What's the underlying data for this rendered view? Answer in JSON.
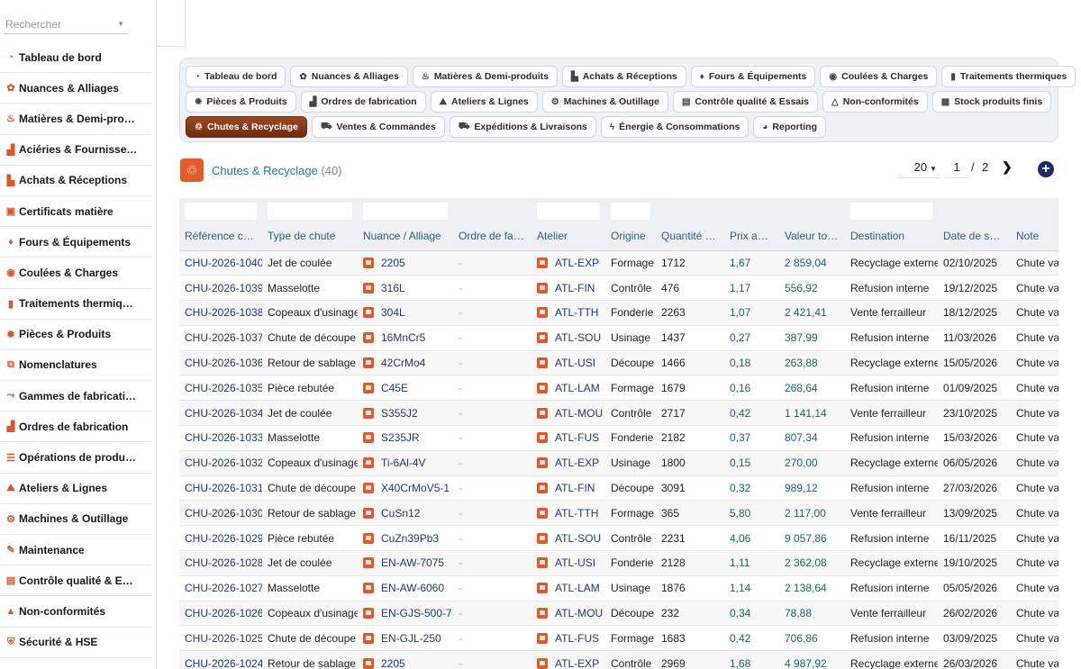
{
  "sidebar": {
    "search_placeholder": "Rechercher",
    "items": [
      {
        "label": "Tableau de bord",
        "icon": "dashboard-icon",
        "glyph": "◔"
      },
      {
        "label": "Nuances & Alliages",
        "icon": "gear-icon",
        "glyph": "✿"
      },
      {
        "label": "Matières & Demi-pro…",
        "icon": "materials-icon",
        "glyph": "♨"
      },
      {
        "label": "Aciéries & Fournisse…",
        "icon": "factory-icon",
        "glyph": "▟"
      },
      {
        "label": "Achats & Réceptions",
        "icon": "truck-icon",
        "glyph": "▙"
      },
      {
        "label": "Certificats matière",
        "icon": "certificate-icon",
        "glyph": "▣"
      },
      {
        "label": "Fours & Équipements",
        "icon": "fire-icon",
        "glyph": "♦"
      },
      {
        "label": "Coulées & Charges",
        "icon": "pour-icon",
        "glyph": "◉"
      },
      {
        "label": "Traitements thermiq…",
        "icon": "thermometer-icon",
        "glyph": "▮"
      },
      {
        "label": "Pièces & Produits",
        "icon": "part-icon",
        "glyph": "✹"
      },
      {
        "label": "Nomenclatures",
        "icon": "hierarchy-icon",
        "glyph": "⧉"
      },
      {
        "label": "Gammes de fabricati…",
        "icon": "routing-icon",
        "glyph": "⤳"
      },
      {
        "label": "Ordres de fabrication",
        "icon": "factory-icon",
        "glyph": "▟"
      },
      {
        "label": "Opérations de produ…",
        "icon": "list-icon",
        "glyph": "☰"
      },
      {
        "label": "Ateliers & Lignes",
        "icon": "workshop-icon",
        "glyph": "⛰"
      },
      {
        "label": "Machines & Outillage",
        "icon": "cogs-icon",
        "glyph": "⚙"
      },
      {
        "label": "Maintenance",
        "icon": "wrench-icon",
        "glyph": "✎"
      },
      {
        "label": "Contrôle qualité & E…",
        "icon": "clipboard-icon",
        "glyph": "▤"
      },
      {
        "label": "Non-conformités",
        "icon": "warning-icon",
        "glyph": "▲"
      },
      {
        "label": "Sécurité & HSE",
        "icon": "shield-icon",
        "glyph": "⛨"
      }
    ]
  },
  "tabs": {
    "rows": [
      [
        {
          "label": "Tableau de bord",
          "icon": "dashboard-icon",
          "glyph": "◔"
        },
        {
          "label": "Nuances & Alliages",
          "icon": "gear-icon",
          "glyph": "✿"
        },
        {
          "label": "Matières & Demi-produits",
          "icon": "materials-icon",
          "glyph": "♨"
        },
        {
          "label": "Achats & Réceptions",
          "icon": "truck-icon",
          "glyph": "▙"
        },
        {
          "label": "Fours & Équipements",
          "icon": "fire-icon",
          "glyph": "♦"
        },
        {
          "label": "Coulées & Charges",
          "icon": "pour-icon",
          "glyph": "◉"
        },
        {
          "label": "Traitements thermiques",
          "icon": "thermometer-icon",
          "glyph": "▮"
        }
      ],
      [
        {
          "label": "Pièces & Produits",
          "icon": "part-icon",
          "glyph": "✹"
        },
        {
          "label": "Ordres de fabrication",
          "icon": "factory-icon",
          "glyph": "▟"
        },
        {
          "label": "Ateliers & Lignes",
          "icon": "workshop-icon",
          "glyph": "⛰"
        },
        {
          "label": "Machines & Outillage",
          "icon": "cogs-icon",
          "glyph": "⚙"
        },
        {
          "label": "Contrôle qualité & Essais",
          "icon": "clipboard-icon",
          "glyph": "▤"
        },
        {
          "label": "Non-conformités",
          "icon": "warning-icon",
          "glyph": "△"
        },
        {
          "label": "Stock produits finis",
          "icon": "warehouse-icon",
          "glyph": "▦"
        }
      ],
      [
        {
          "label": "Chutes & Recyclage",
          "icon": "recycle-icon",
          "glyph": "♲",
          "active": true
        },
        {
          "label": "Ventes & Commandes",
          "icon": "cart-icon",
          "glyph": "⛟"
        },
        {
          "label": "Expéditions & Livraisons",
          "icon": "truck-icon",
          "glyph": "⛟"
        },
        {
          "label": "Énergie & Consommations",
          "icon": "bolt-icon",
          "glyph": "ϟ"
        },
        {
          "label": "Reporting",
          "icon": "chart-icon",
          "glyph": "◕"
        }
      ]
    ]
  },
  "page": {
    "title": "Chutes & Recyclage",
    "count": "(40)",
    "page_size": "20",
    "current_page": "1",
    "separator": "/",
    "total_pages": "2"
  },
  "table": {
    "columns": [
      "Référence ch…",
      "Type de chute",
      "Nuance / Alliage",
      "Ordre de fab…",
      "Atelier",
      "Origine",
      "Quantité (kg)",
      "Prix au kg",
      "Valeur totale",
      "Destination",
      "Date de sortie",
      "Note"
    ],
    "rows": [
      [
        "CHU-2026-1040",
        "Jet de coulée",
        "2205",
        "-",
        "ATL-EXP",
        "Formage",
        "1712",
        "1,67",
        "2 859,04",
        "Recyclage externe",
        "02/10/2025",
        "Chute val"
      ],
      [
        "CHU-2026-1039",
        "Masselotte",
        "316L",
        "-",
        "ATL-FIN",
        "Contrôle",
        "476",
        "1,17",
        "556,92",
        "Refusion interne",
        "19/12/2025",
        "Chute val"
      ],
      [
        "CHU-2026-1038",
        "Copeaux d'usinage",
        "304L",
        "-",
        "ATL-TTH",
        "Fonderie",
        "2263",
        "1,07",
        "2 421,41",
        "Vente ferrailleur",
        "18/12/2025",
        "Chute val"
      ],
      [
        "CHU-2026-1037",
        "Chute de découpe",
        "16MnCr5",
        "-",
        "ATL-SOU",
        "Usinage",
        "1437",
        "0,27",
        "387,99",
        "Refusion interne",
        "11/03/2026",
        "Chute val"
      ],
      [
        "CHU-2026-1036",
        "Retour de sablage",
        "42CrMo4",
        "-",
        "ATL-USI",
        "Découpe",
        "1466",
        "0,18",
        "263,88",
        "Recyclage externe",
        "15/05/2026",
        "Chute val"
      ],
      [
        "CHU-2026-1035",
        "Pièce rebutée",
        "C45E",
        "-",
        "ATL-LAM",
        "Formage",
        "1679",
        "0,16",
        "268,64",
        "Refusion interne",
        "01/09/2025",
        "Chute val"
      ],
      [
        "CHU-2026-1034",
        "Jet de coulée",
        "S355J2",
        "-",
        "ATL-MOU",
        "Contrôle",
        "2717",
        "0,42",
        "1 141,14",
        "Vente ferrailleur",
        "23/10/2025",
        "Chute val"
      ],
      [
        "CHU-2026-1033",
        "Masselotte",
        "S235JR",
        "-",
        "ATL-FUS",
        "Fonderie",
        "2182",
        "0,37",
        "807,34",
        "Refusion interne",
        "15/03/2026",
        "Chute val"
      ],
      [
        "CHU-2026-1032",
        "Copeaux d'usinage",
        "Ti-6Al-4V",
        "-",
        "ATL-EXP",
        "Usinage",
        "1800",
        "0,15",
        "270,00",
        "Recyclage externe",
        "06/05/2026",
        "Chute val"
      ],
      [
        "CHU-2026-1031",
        "Chute de découpe",
        "X40CrMoV5-1",
        "-",
        "ATL-FIN",
        "Découpe",
        "3091",
        "0,32",
        "989,12",
        "Refusion interne",
        "27/03/2026",
        "Chute val"
      ],
      [
        "CHU-2026-1030",
        "Retour de sablage",
        "CuSn12",
        "-",
        "ATL-TTH",
        "Formage",
        "365",
        "5,80",
        "2 117,00",
        "Vente ferrailleur",
        "13/09/2025",
        "Chute val"
      ],
      [
        "CHU-2026-1029",
        "Pièce rebutée",
        "CuZn39Pb3",
        "-",
        "ATL-SOU",
        "Contrôle",
        "2231",
        "4,06",
        "9 057,86",
        "Refusion interne",
        "16/11/2025",
        "Chute val"
      ],
      [
        "CHU-2026-1028",
        "Jet de coulée",
        "EN-AW-7075",
        "-",
        "ATL-USI",
        "Fonderie",
        "2128",
        "1,11",
        "2 362,08",
        "Recyclage externe",
        "19/10/2025",
        "Chute val"
      ],
      [
        "CHU-2026-1027",
        "Masselotte",
        "EN-AW-6060",
        "-",
        "ATL-LAM",
        "Usinage",
        "1876",
        "1,14",
        "2 138,64",
        "Refusion interne",
        "05/05/2026",
        "Chute val"
      ],
      [
        "CHU-2026-1026",
        "Copeaux d'usinage",
        "EN-GJS-500-7",
        "-",
        "ATL-MOU",
        "Découpe",
        "232",
        "0,34",
        "78,88",
        "Vente ferrailleur",
        "26/02/2026",
        "Chute val"
      ],
      [
        "CHU-2026-1025",
        "Chute de découpe",
        "EN-GJL-250",
        "-",
        "ATL-FUS",
        "Formage",
        "1683",
        "0,42",
        "706,86",
        "Refusion interne",
        "03/09/2025",
        "Chute val"
      ],
      [
        "CHU-2026-1024",
        "Retour de sablage",
        "2205",
        "-",
        "ATL-EXP",
        "Contrôle",
        "2969",
        "1,68",
        "4 987,92",
        "Recyclage externe",
        "26/03/2026",
        "Chute val"
      ]
    ]
  },
  "colors": {
    "accent": "#e45a28",
    "active_tab": "#8a3a17",
    "link": "#1b3b74",
    "teal": "#17666e",
    "add_button": "#1b2a6e"
  }
}
